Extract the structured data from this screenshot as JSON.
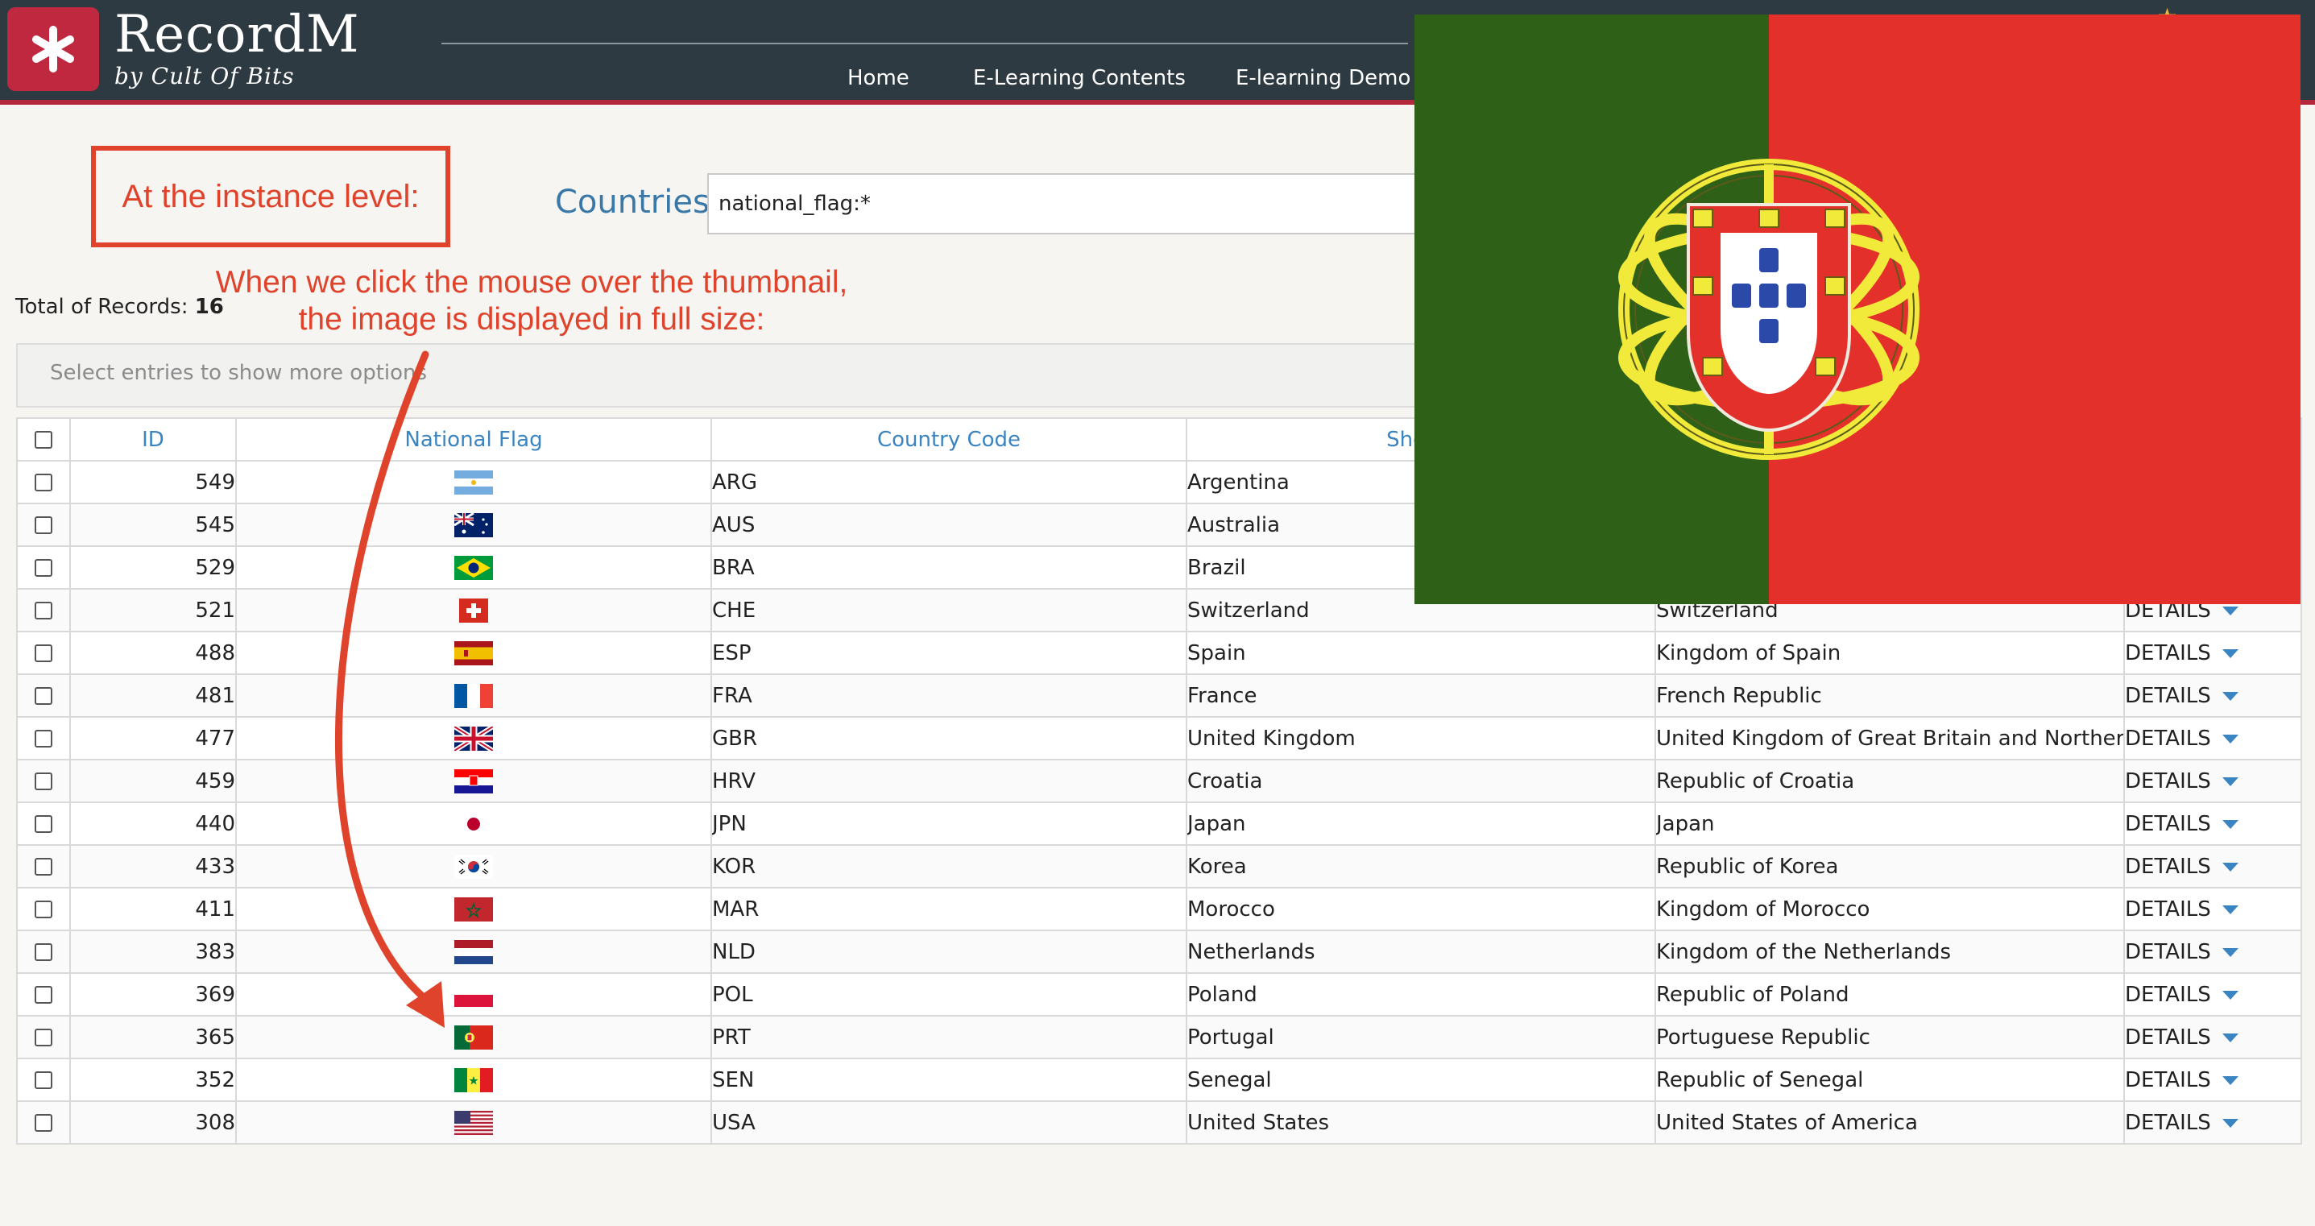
{
  "app": {
    "title": "RecordM",
    "subtitle": "by Cult Of Bits",
    "nav": [
      {
        "label": "Home"
      },
      {
        "label": "E-Learning Contents"
      },
      {
        "label": "E-learning Demo"
      }
    ]
  },
  "annotations": {
    "box_label": "At the instance level:",
    "note_line1": "When we click the mouse over the thumbnail,",
    "note_line2": "the image is displayed in full size:",
    "color": "#e0432b"
  },
  "search": {
    "label": "Countries",
    "value": "national_flag:*"
  },
  "summary": {
    "total_label": "Total of Records:",
    "total_value": "16",
    "options_hint": "Select entries to show more options"
  },
  "table": {
    "columns": [
      "ID",
      "National Flag",
      "Country Code",
      "Short I"
    ],
    "details_label": "DETAILS",
    "rows": [
      {
        "id": "549",
        "flag": "argentina-flag",
        "code": "ARG",
        "short": "Argentina",
        "official": ""
      },
      {
        "id": "545",
        "flag": "australia-flag",
        "code": "AUS",
        "short": "Australia",
        "official": ""
      },
      {
        "id": "529",
        "flag": "brazil-flag",
        "code": "BRA",
        "short": "Brazil",
        "official": ""
      },
      {
        "id": "521",
        "flag": "switzerland-flag",
        "code": "CHE",
        "short": "Switzerland",
        "official": "Switzerland"
      },
      {
        "id": "488",
        "flag": "spain-flag",
        "code": "ESP",
        "short": "Spain",
        "official": "Kingdom of Spain"
      },
      {
        "id": "481",
        "flag": "france-flag",
        "code": "FRA",
        "short": "France",
        "official": "French Republic"
      },
      {
        "id": "477",
        "flag": "uk-flag",
        "code": "GBR",
        "short": "United Kingdom",
        "official": "United Kingdom of Great Britain and Northern I"
      },
      {
        "id": "459",
        "flag": "croatia-flag",
        "code": "HRV",
        "short": "Croatia",
        "official": "Republic of Croatia"
      },
      {
        "id": "440",
        "flag": "japan-flag",
        "code": "JPN",
        "short": "Japan",
        "official": "Japan"
      },
      {
        "id": "433",
        "flag": "korea-flag",
        "code": "KOR",
        "short": "Korea",
        "official": "Republic of Korea"
      },
      {
        "id": "411",
        "flag": "morocco-flag",
        "code": "MAR",
        "short": "Morocco",
        "official": "Kingdom of Morocco"
      },
      {
        "id": "383",
        "flag": "netherlands-flag",
        "code": "NLD",
        "short": "Netherlands",
        "official": "Kingdom of the Netherlands"
      },
      {
        "id": "369",
        "flag": "poland-flag",
        "code": "POL",
        "short": "Poland",
        "official": "Republic of Poland"
      },
      {
        "id": "365",
        "flag": "portugal-flag",
        "code": "PRT",
        "short": "Portugal",
        "official": "Portuguese Republic"
      },
      {
        "id": "352",
        "flag": "senegal-flag",
        "code": "SEN",
        "short": "Senegal",
        "official": "Republic of Senegal"
      },
      {
        "id": "308",
        "flag": "usa-flag",
        "code": "USA",
        "short": "United States",
        "official": "United States of America"
      }
    ]
  },
  "popup": {
    "image": "portugal-flag-full-size"
  },
  "colors": {
    "header_bg": "#2e3a41",
    "header_accent": "#b3283a",
    "link": "#3a84c1",
    "annotation": "#e0432b"
  }
}
